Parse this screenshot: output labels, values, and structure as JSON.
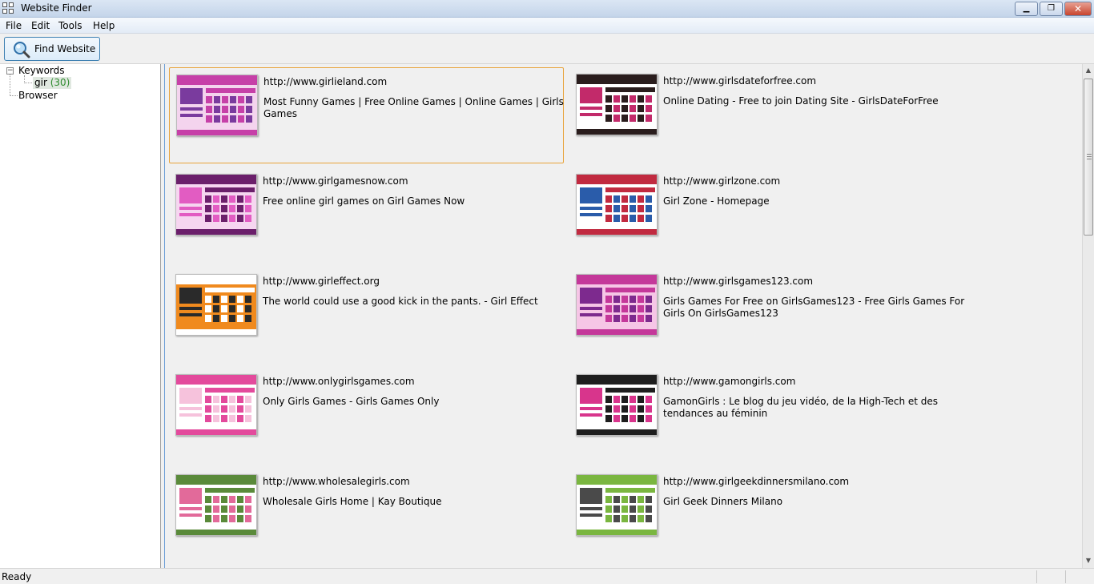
{
  "window": {
    "title": "Website Finder",
    "minimize": "▁",
    "restore": "❐",
    "close": "✕"
  },
  "menu": [
    "File",
    "Edit",
    "Tools",
    "Help"
  ],
  "toolbar": {
    "find_label": "Find Website"
  },
  "tree": {
    "root_label": "Keywords",
    "expander": "−",
    "child_label": "gir",
    "child_count": "(30)",
    "browser_label": "Browser"
  },
  "results": [
    {
      "url": "http://www.girlieland.com",
      "title": "Most Funny Games | Free Online Games | Online Games | Girls Games",
      "theme": [
        "#f4d4ee",
        "#c640a8",
        "#7a3b9e"
      ]
    },
    {
      "url": "http://www.girlsdateforfree.com",
      "title": "Online Dating - Free to join Dating Site - GirlsDateForFree",
      "theme": [
        "#ffffff",
        "#2a1d1d",
        "#c22a6a"
      ]
    },
    {
      "url": "http://www.girlgamesnow.com",
      "title": "Free online girl games on Girl Games Now",
      "theme": [
        "#f6d6f0",
        "#6b1f6b",
        "#e25cc2"
      ]
    },
    {
      "url": "http://www.girlzone.com",
      "title": "Girl Zone - Homepage",
      "theme": [
        "#ffffff",
        "#c12a40",
        "#2a5caa"
      ]
    },
    {
      "url": "http://www.girleffect.org",
      "title": "The world could use a good kick in the pants. - Girl Effect",
      "theme": [
        "#f08a1e",
        "#ffffff",
        "#2a2a2a"
      ]
    },
    {
      "url": "http://www.girlsgames123.com",
      "title": "Girls Games For Free on GirlsGames123 - Free Girls Games For Girls On GirlsGames123",
      "theme": [
        "#f6c6e6",
        "#c4389a",
        "#7d2a8e"
      ]
    },
    {
      "url": "http://www.onlygirlsgames.com",
      "title": "Only Girls Games - Girls Games Only",
      "theme": [
        "#ffffff",
        "#e34a9c",
        "#f6c2dc"
      ]
    },
    {
      "url": "http://www.gamongirls.com",
      "title": "GamonGirls : Le blog du jeu vidéo, de la High-Tech et des tendances au féminin",
      "theme": [
        "#ffffff",
        "#1e1e1e",
        "#d8358c"
      ]
    },
    {
      "url": "http://www.wholesalegirls.com",
      "title": "Wholesale Girls Home | Kay Boutique",
      "theme": [
        "#ffffff",
        "#5a8a3a",
        "#e26a9a"
      ]
    },
    {
      "url": "http://www.girlgeekdinnersmilano.com",
      "title": "Girl Geek Dinners Milano",
      "theme": [
        "#ffffff",
        "#7ab640",
        "#4a4a4a"
      ]
    }
  ],
  "status": {
    "text": "Ready"
  }
}
